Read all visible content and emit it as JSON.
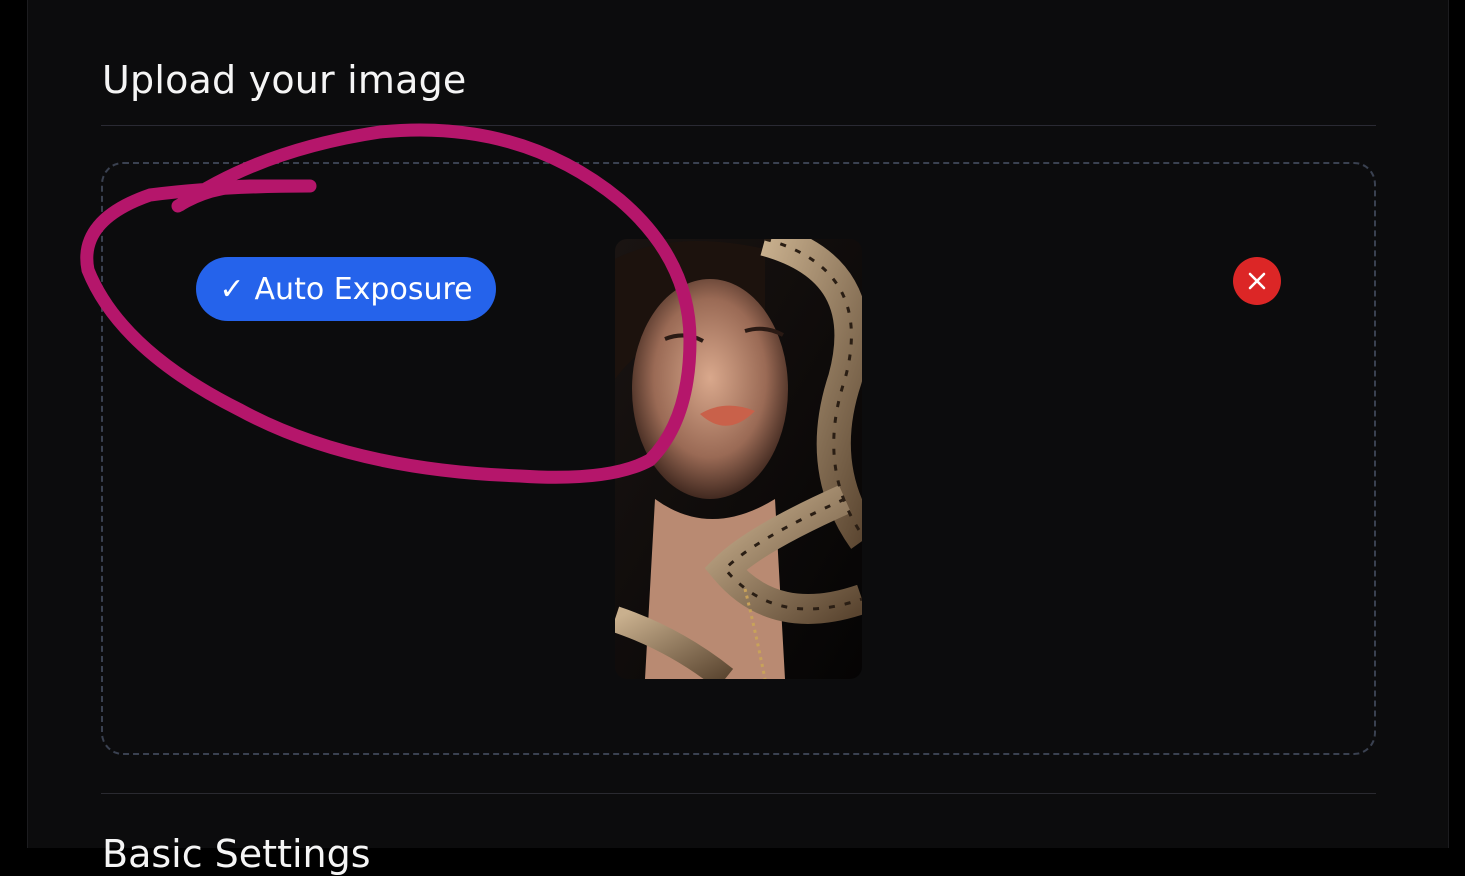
{
  "section": {
    "title": "Upload your image",
    "next_title": "Basic Settings"
  },
  "upload": {
    "auto_exposure_label": "Auto Exposure",
    "check_glyph": "✓",
    "remove_icon": "close-icon",
    "preview_subject": "portrait with snakes"
  },
  "colors": {
    "accent": "#2563eb",
    "danger": "#dc2626",
    "annotation": "#b5166b",
    "background": "#0c0c0d"
  }
}
